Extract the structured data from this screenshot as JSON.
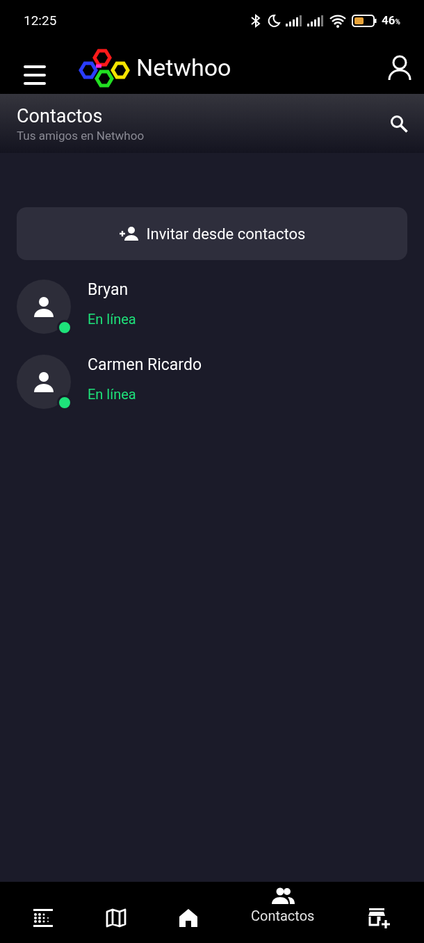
{
  "status_bar": {
    "time": "12:25",
    "battery": "46",
    "battery_unit": "%"
  },
  "app_bar": {
    "brand": "Netwhoo"
  },
  "header": {
    "title": "Contactos",
    "subtitle": "Tus amigos en Netwhoo"
  },
  "invite_button": {
    "label": "Invitar desde contactos"
  },
  "contacts": [
    {
      "name": "Bryan",
      "status": "En línea",
      "online": true
    },
    {
      "name": "Carmen Ricardo",
      "status": "En línea",
      "online": true
    }
  ],
  "bottom_nav": [
    {
      "kind": "grid",
      "selected": false
    },
    {
      "kind": "map",
      "selected": false
    },
    {
      "kind": "home",
      "selected": false
    },
    {
      "kind": "people",
      "label": "Contactos",
      "selected": true
    },
    {
      "kind": "store",
      "selected": false
    }
  ]
}
